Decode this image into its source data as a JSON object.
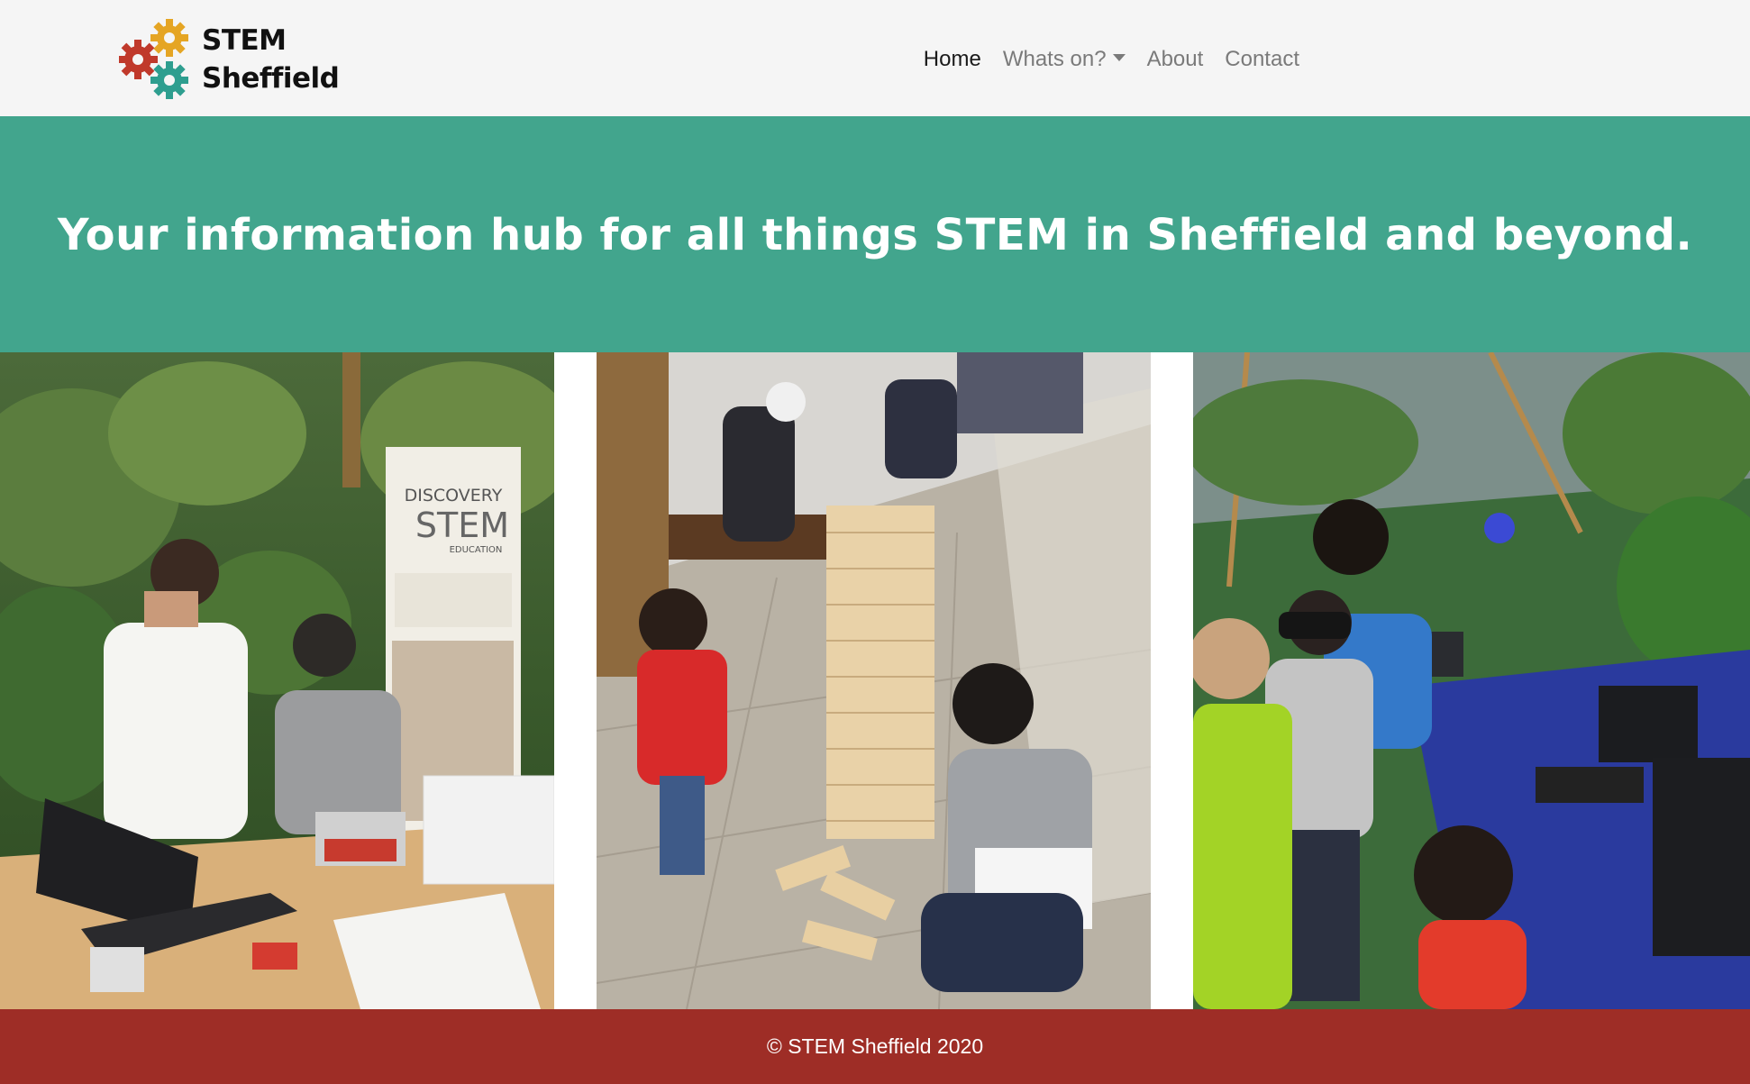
{
  "navbar": {
    "brand": {
      "line1": "STEM",
      "line2": "Sheffield",
      "logo_icon": "gears-logo-icon",
      "colors": {
        "red_gear": "#c0392b",
        "yellow_gear": "#e5a524",
        "teal_gear": "#2e9e8f"
      }
    },
    "links": [
      {
        "label": "Home",
        "active": true
      },
      {
        "label": "Whats on?",
        "dropdown": true
      },
      {
        "label": "About"
      },
      {
        "label": "Contact"
      }
    ]
  },
  "hero": {
    "text_part1": "Your information hub for ",
    "text_bold": "all things STEM",
    "text_part2": " in Sheffield and beyond.",
    "background": "#42a58d"
  },
  "gallery": {
    "photos": [
      {
        "description_icon": "photo-robotics-workshop",
        "banner_line1": "DISCOVERY",
        "banner_line2": "STEM",
        "banner_line3": "EDUCATION"
      },
      {
        "description_icon": "photo-giant-jenga"
      },
      {
        "description_icon": "photo-vr-stand"
      }
    ]
  },
  "footer": {
    "text": "© STEM Sheffield 2020",
    "background": "#9e2d26"
  }
}
